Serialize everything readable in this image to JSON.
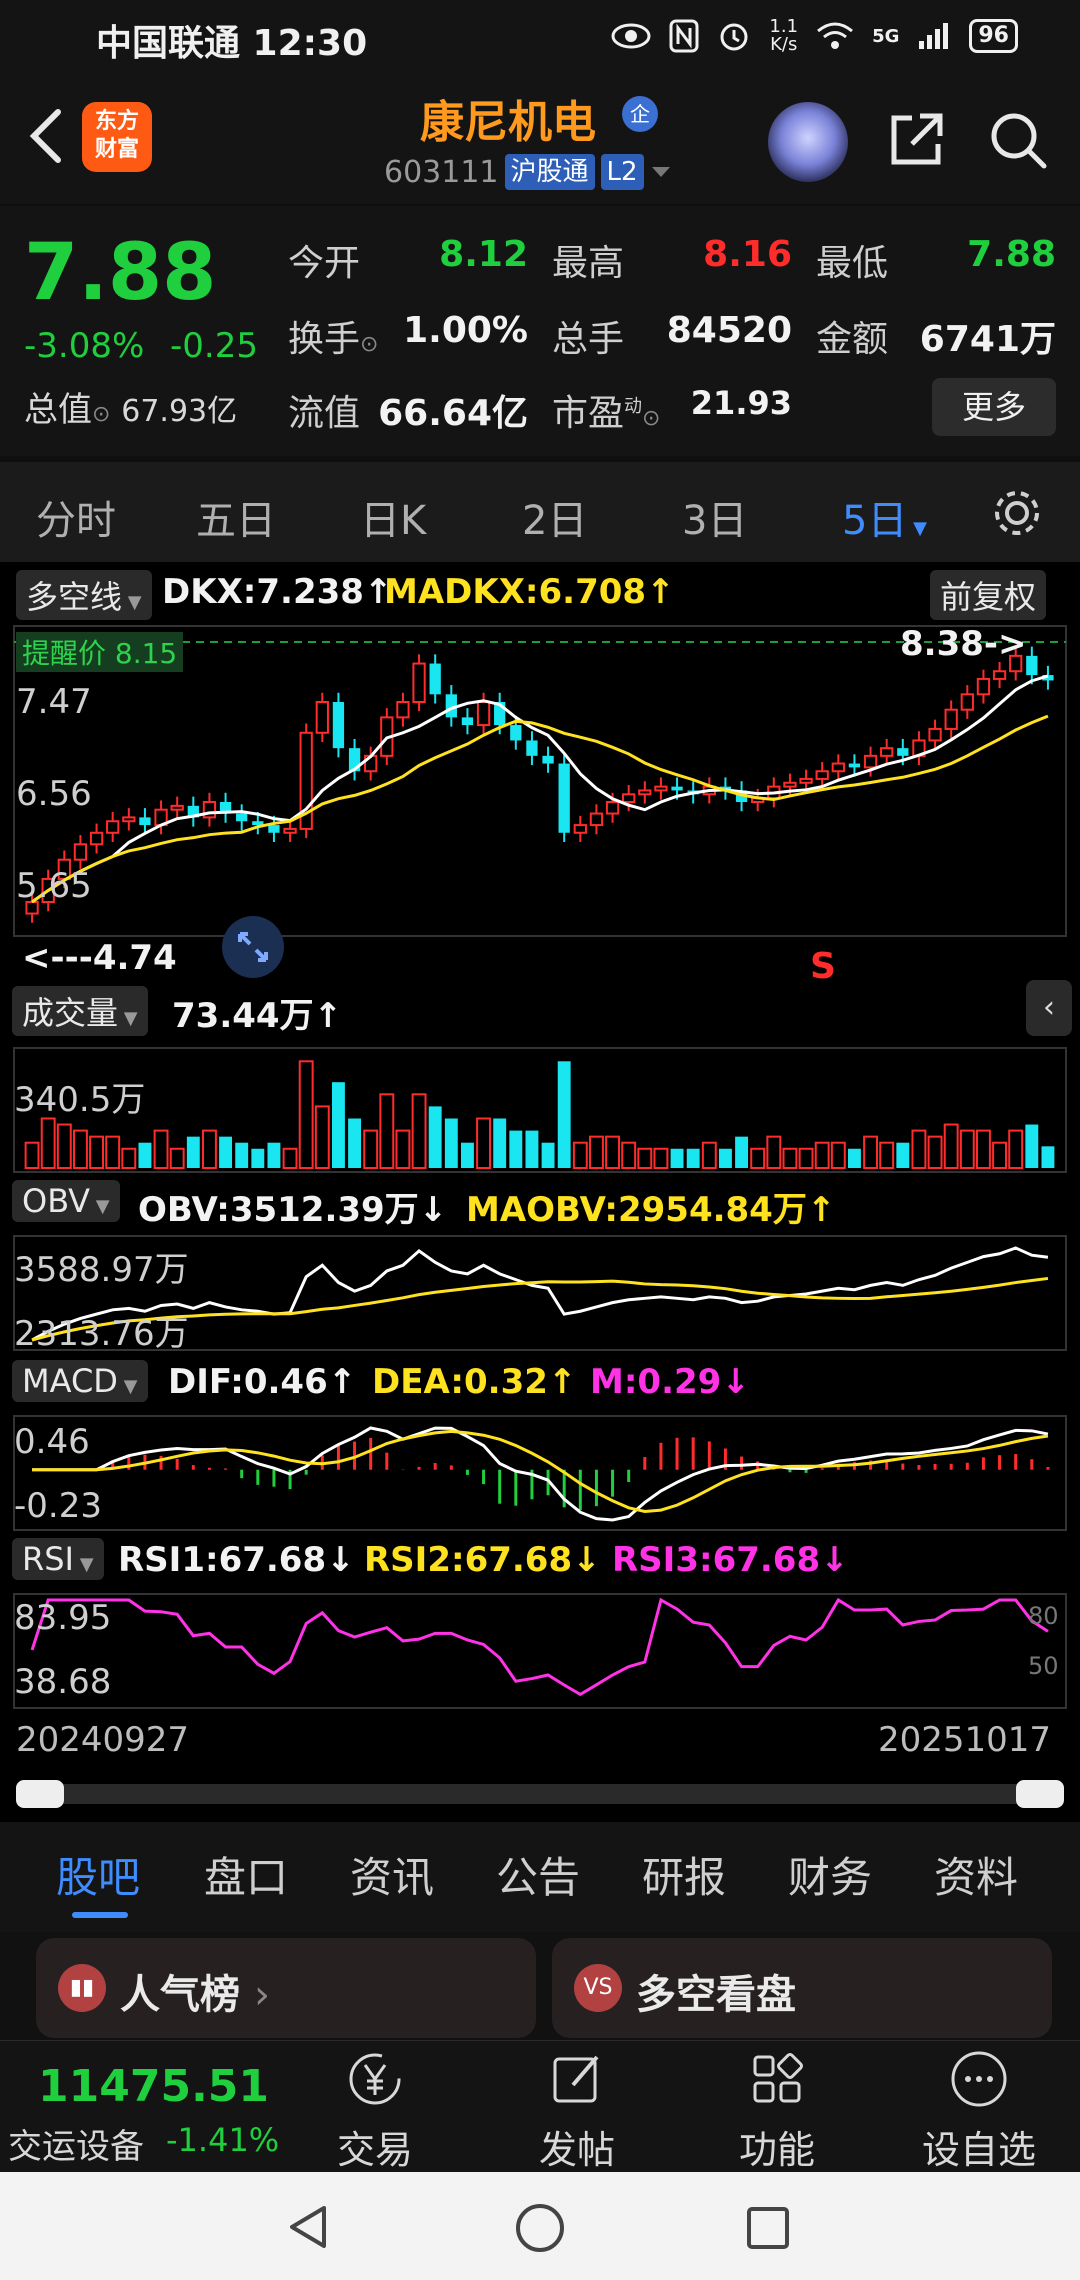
{
  "status_bar": {
    "carrier_time": "中国联通 12:30",
    "speed": "1.1\nK/s",
    "network": "5G",
    "battery": "96"
  },
  "header": {
    "title": "康尼机电",
    "code": "603111",
    "market_tag": "沪股通",
    "level_tag": "L2",
    "badge": "企",
    "logo_text": "东方\n财富"
  },
  "quote": {
    "price": "7.88",
    "change_pct": "-3.08%",
    "change": "-0.25",
    "total_value_label": "总值",
    "total_value": "67.93亿",
    "open_label": "今开",
    "open": "8.12",
    "high_label": "最高",
    "high": "8.16",
    "low_label": "最低",
    "low": "7.88",
    "turnover_label": "换手",
    "turnover": "1.00%",
    "volume_label": "总手",
    "volume": "84520",
    "amount_label": "金额",
    "amount": "6741万",
    "float_label": "流值",
    "float_value": "66.64亿",
    "pe_label": "市盈",
    "pe_sup": "动",
    "pe": "21.93",
    "more": "更多"
  },
  "period_tabs": [
    "分时",
    "五日",
    "日K",
    "2日",
    "3日",
    "5日"
  ],
  "active_period": "5日",
  "chart": {
    "indicator_name": "多空线",
    "dkx": "DKX:7.238↑",
    "madkx": "MADKX:6.708↑",
    "adjust": "前复权",
    "remind_label": "提醒价 8.15",
    "y_labels": [
      "8.38",
      "7.47",
      "6.56",
      "5.65",
      "4.74"
    ],
    "max_marker": "8.38->",
    "min_marker": "<---4.74",
    "s_marker": "S",
    "volume_label": "成交量",
    "volume_value": "73.44万↑",
    "volume_axis": "340.5万",
    "obv_label": "OBV",
    "obv": "OBV:3512.39万↓",
    "maobv": "MAOBV:2954.84万↑",
    "obv_axis_top": "3588.97万",
    "obv_axis_bottom": "2313.76万",
    "macd_label": "MACD",
    "dif": "DIF:0.46↑",
    "dea": "DEA:0.32↑",
    "m": "M:0.29↓",
    "macd_axis_top": "0.46",
    "macd_axis_bottom": "-0.23",
    "rsi_label": "RSI",
    "rsi1": "RSI1:67.68↓",
    "rsi2": "RSI2:67.68↓",
    "rsi3": "RSI3:67.68↓",
    "rsi_axis_top": "83.95",
    "rsi_axis_bottom": "38.68",
    "rsi_right_top": "80",
    "rsi_right_bottom": "50",
    "date_start": "20240927",
    "date_end": "20251017"
  },
  "chart_data": {
    "type": "candlestick",
    "x_range": [
      "20240927",
      "20251017"
    ],
    "y_range": [
      4.74,
      8.38
    ],
    "close": [
      5.0,
      5.3,
      5.55,
      5.75,
      5.9,
      6.05,
      6.1,
      6.0,
      6.2,
      6.25,
      6.1,
      6.3,
      6.15,
      6.05,
      6.0,
      5.9,
      5.95,
      7.2,
      7.6,
      7.0,
      6.7,
      6.9,
      7.4,
      7.6,
      8.1,
      7.7,
      7.4,
      7.3,
      7.6,
      7.3,
      7.1,
      6.9,
      6.8,
      5.9,
      6.0,
      6.15,
      6.3,
      6.4,
      6.45,
      6.5,
      6.45,
      6.4,
      6.5,
      6.45,
      6.3,
      6.35,
      6.5,
      6.55,
      6.6,
      6.7,
      6.8,
      6.75,
      6.9,
      7.0,
      6.9,
      7.1,
      7.25,
      7.5,
      7.7,
      7.9,
      8.0,
      8.2,
      7.95,
      7.88
    ]
  },
  "bottom_tabs": [
    "股吧",
    "盘口",
    "资讯",
    "公告",
    "研报",
    "财务",
    "资料"
  ],
  "cards": [
    "人气榜",
    "多空看盘"
  ],
  "footer": {
    "index_value": "11475.51",
    "index_name": "交运设备",
    "index_change": "-1.41%",
    "buttons": [
      "交易",
      "发帖",
      "功能",
      "设自选"
    ]
  },
  "colors": {
    "up": "#ff2c2c",
    "down": "#1fcf3d",
    "accent": "#3f8cff",
    "dkx": "#ffffff",
    "madkx": "#ffe21f",
    "rsi": "#ff32e6"
  }
}
